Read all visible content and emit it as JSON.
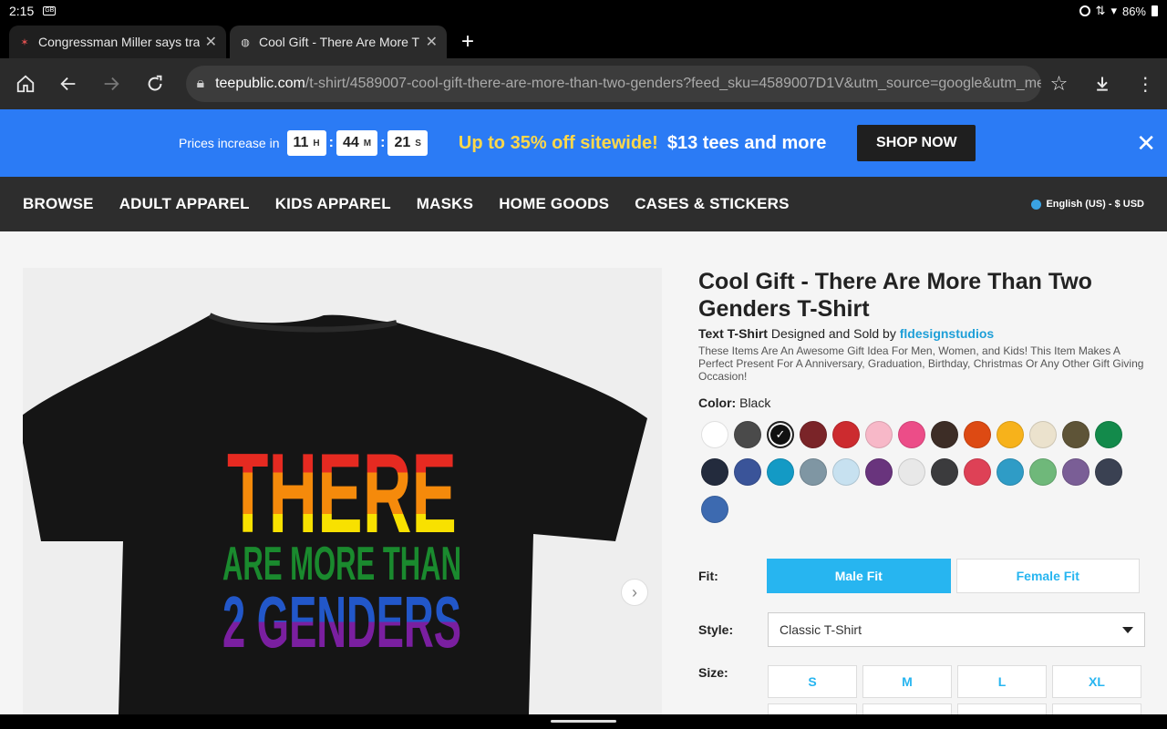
{
  "status": {
    "time": "2:15",
    "battery": "86%"
  },
  "tabs": [
    {
      "title": "Congressman Miller says tra"
    },
    {
      "title": "Cool Gift - There Are More Th"
    }
  ],
  "toolbar": {
    "url_host": "teepublic.com",
    "url_path": "/t-shirt/4589007-cool-gift-there-are-more-than-two-genders?feed_sku=4589007D1V&utm_source=google&utm_medi"
  },
  "promo": {
    "prices_text": "Prices increase in",
    "hours": "11",
    "hours_unit": "H",
    "minutes": "44",
    "minutes_unit": "M",
    "seconds": "21",
    "seconds_unit": "S",
    "deal": "Up to 35% off sitewide!",
    "deal2": "$13 tees and more",
    "cta": "SHOP NOW"
  },
  "nav": {
    "items": [
      "BROWSE",
      "ADULT APPAREL",
      "KIDS APPAREL",
      "MASKS",
      "HOME GOODS",
      "CASES & STICKERS"
    ],
    "language": "English (US) - $ USD"
  },
  "product": {
    "title": "Cool Gift - There Are More Than Two Genders T-Shirt",
    "type": "Text T-Shirt",
    "designed_by": "Designed and Sold by",
    "artist": "fldesignstudios",
    "description": "These Items Are An Awesome Gift Idea For Men, Women, and Kids! This Item Makes A Perfect Present For A Anniversary, Graduation, Birthday, Christmas Or Any Other Gift Giving Occasion!",
    "color_label": "Color:",
    "color_value": "Black",
    "shirt_text": {
      "line1": "THERE",
      "line2": "ARE MORE THAN",
      "line3": "2 GENDERS"
    },
    "swatches": [
      "#ffffff",
      "#4a4a4a",
      "#111111",
      "#7a2428",
      "#cc2b2f",
      "#f7b8c8",
      "#ec4d88",
      "#3d2d26",
      "#dd4a13",
      "#f7b21b",
      "#ebe2cd",
      "#5e5437",
      "#138a4b",
      "#232b3d",
      "#3a5499",
      "#139ac5",
      "#7f96a3",
      "#c7e1f0",
      "#69347d",
      "#e8e8e8",
      "#3b3b3d",
      "#de4156",
      "#2f9cc6",
      "#6fb87a",
      "#7a5e96",
      "#3a4152",
      "#3d6ab0"
    ],
    "fit_label": "Fit:",
    "fit_male": "Male Fit",
    "fit_female": "Female Fit",
    "style_label": "Style:",
    "style_value": "Classic T-Shirt",
    "size_label": "Size:",
    "sizes": [
      "S",
      "M",
      "L",
      "XL"
    ]
  }
}
